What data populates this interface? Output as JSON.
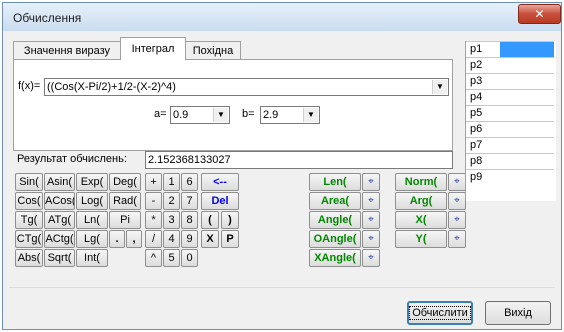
{
  "window": {
    "title": "Обчислення"
  },
  "tabs": [
    {
      "label": "Значення виразу",
      "active": false
    },
    {
      "label": "Інтеграл",
      "active": true
    },
    {
      "label": "Похідна",
      "active": false
    }
  ],
  "integral": {
    "fx_label": "f(x)=",
    "fx_value": "((Cos(X-Pi/2)+1/2-(X-2)^4)",
    "a_label": "a=",
    "a_value": "0.9",
    "b_label": "b=",
    "b_value": "2.9"
  },
  "result": {
    "label": "Результат обчислень:",
    "value": "2.152368133027"
  },
  "keypad": {
    "functions": [
      "Sin(",
      "Asin(",
      "Exp(",
      "Deg(",
      "Cos(",
      "ACos(",
      "Log(",
      "Rad(",
      "Tg(",
      "ATg(",
      "Ln(",
      "Pi",
      "CTg(",
      "ACtg(",
      "Lg(",
      "Abs(",
      "Sqrt(",
      "Int("
    ],
    "operators": [
      "+",
      "-",
      "*",
      "/",
      "^"
    ],
    "digits": [
      "1",
      "6",
      "2",
      "7",
      "3",
      "8",
      "4",
      "9",
      "5",
      "0"
    ],
    "dot": ".",
    "comma": ",",
    "backspace": "<--",
    "delete": "Del",
    "paren_open": "(",
    "paren_close": ")",
    "var_x": "X",
    "var_p": "P"
  },
  "geometry_funcs": [
    "Len(",
    "Area(",
    "Angle(",
    "OAngle(",
    "XAngle(",
    "Norm(",
    "Arg(",
    "X(",
    "Y("
  ],
  "params": [
    "p1",
    "p2",
    "p3",
    "p4",
    "p5",
    "p6",
    "p7",
    "p8",
    "p9"
  ],
  "buttons": {
    "calculate": "Обчислити",
    "exit": "Вихід"
  },
  "colors": {
    "selection": "#3399ff",
    "func_green": "#008800",
    "edit_blue": "#0000ee"
  }
}
